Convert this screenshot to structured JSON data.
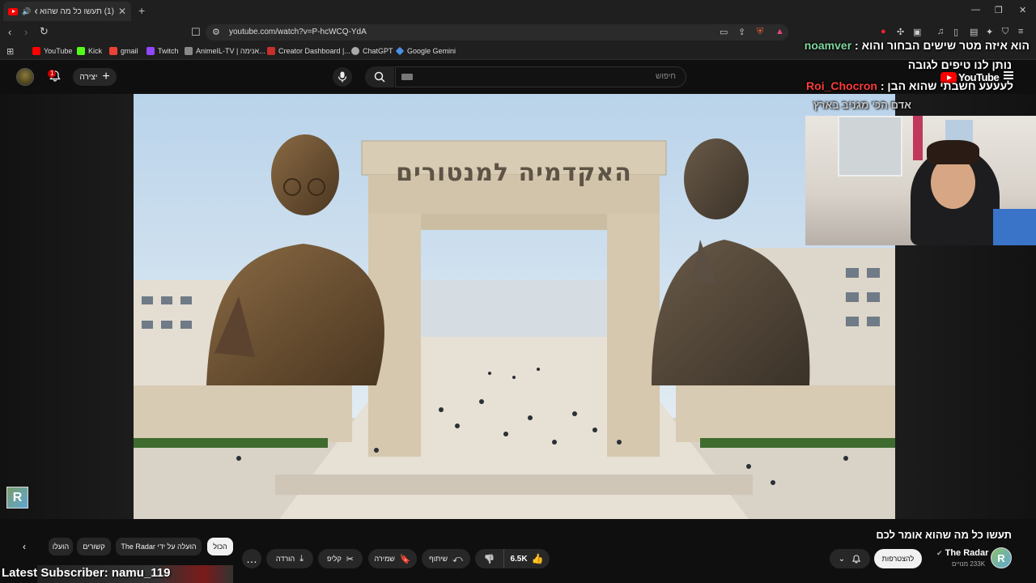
{
  "browser": {
    "tab_title": "(1) תעשו כל מה שהוא אומר ל",
    "url": "youtube.com/watch?v=P-hcWCQ-YdA",
    "bookmarks": [
      {
        "label": "YouTube",
        "color": "#ff0000"
      },
      {
        "label": "Kick",
        "color": "#53fc18"
      },
      {
        "label": "gmail",
        "color": "#ea4335"
      },
      {
        "label": "Twitch",
        "color": "#9146ff"
      },
      {
        "label": "AnimeIL-TV | אנימה...",
        "color": "#888888"
      },
      {
        "label": "Creator Dashboard |...",
        "color": "#c4302b"
      },
      {
        "label": "ChatGPT",
        "color": "#aaaaaa"
      },
      {
        "label": "Google Gemini",
        "color": "#4a90e2"
      }
    ]
  },
  "header": {
    "notification_count": "1",
    "create_label": "יצירה",
    "search_placeholder": "חיפוש",
    "logo_text": "YouTube"
  },
  "video": {
    "arch_text": "האקדמיה למנטורים"
  },
  "chat": [
    {
      "user": "noamver",
      "text": "הוא איזה מטר שישים הבחור והוא :",
      "user_color": "#7ed6a0"
    },
    {
      "user": "",
      "text": "נותן לנו טיפים לגובה",
      "user_color": "#ffffff"
    },
    {
      "user": "Roi_Chocron",
      "text": "לעעעע חשבתי שהוא הבן :",
      "user_color": "#ff3b3b"
    },
    {
      "user": "",
      "text": "אדם הכי מגניב בארץ",
      "user_color": "#ffffff"
    }
  ],
  "below": {
    "title": "תעשו כל מה שהוא אומר לכם",
    "channel_name": "The Radar",
    "subs": "233K מנויים",
    "subscribe_label": "להצטרפות",
    "likes": "6.5K",
    "share_label": "שיתוף",
    "save_label": "שמירה",
    "clip_label": "קליפ",
    "download_label": "הורדה",
    "chips": [
      "הכול",
      "הועלה על ידי The Radar",
      "קשורים",
      "הועלו"
    ]
  },
  "overlay": {
    "latest_subscriber": "Latest Subscriber: namu_119"
  },
  "colors": {
    "background": "#0f0f0f",
    "accent": "#ff0000"
  }
}
